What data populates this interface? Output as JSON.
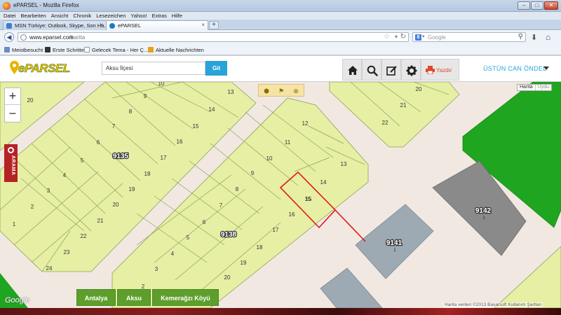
{
  "window": {
    "title": "ePARSEL - Mozilla Firefox",
    "menu": [
      "Datei",
      "Bearbeiten",
      "Ansicht",
      "Chronik",
      "Lesezeichen",
      "Yahoo!",
      "Extras",
      "Hilfe"
    ],
    "tabs": [
      {
        "label": "MSN Türkiye: Outlook, Skype, Son Ha...",
        "active": false
      },
      {
        "label": "ePARSEL",
        "active": true
      }
    ],
    "url_host": "www.eparsel.com",
    "url_path": "/harita",
    "search_placeholder": "Google",
    "bookmarks": [
      "Meistbesucht",
      "Erste Schritte",
      "Gelecek Tema - Her Ç...",
      "Aktuelle Nachrichten"
    ]
  },
  "app": {
    "logo_text": "ePARSEL",
    "search_value": "Aksu İlçesi",
    "go_label": "Git",
    "print_label": "Yazdır",
    "user_name": "ÜSTÜN CAN ÖNDEL"
  },
  "map": {
    "type_map": "Harita",
    "type_sat": "Uydu",
    "side_tab": "ARAMA",
    "attribution": "Harita verileri ©2013 Basarsoft    Kullanım Şartları",
    "google": "Google",
    "breadcrumbs": [
      "Antalya",
      "Aksu",
      "Kemerağzı Köyü"
    ],
    "blocks": [
      "9135",
      "9138",
      "9141",
      "9142"
    ],
    "block_sub": [
      "1",
      "1"
    ],
    "selected_parcel": "15",
    "parcels_left": [
      "20",
      "9",
      "8",
      "7",
      "6",
      "5",
      "4",
      "3",
      "2",
      "1",
      "14",
      "15",
      "16",
      "17",
      "18",
      "19",
      "20",
      "21",
      "22",
      "23",
      "24",
      "13",
      "10"
    ],
    "parcels_right": [
      "12",
      "11",
      "10",
      "9",
      "14",
      "13",
      "8",
      "15",
      "16",
      "7",
      "6",
      "5",
      "17",
      "18",
      "4",
      "3",
      "19",
      "20",
      "2"
    ],
    "parcels_top_right": [
      "20",
      "21",
      "22"
    ],
    "colors": {
      "parcel": "#e6efa4",
      "parcel_stroke": "#8ea35a",
      "road": "#f1e8e2",
      "green": "#1fa51f",
      "grey": "#8a8a8a",
      "blue_grey": "#9daab3",
      "selected": "#e01818"
    }
  }
}
